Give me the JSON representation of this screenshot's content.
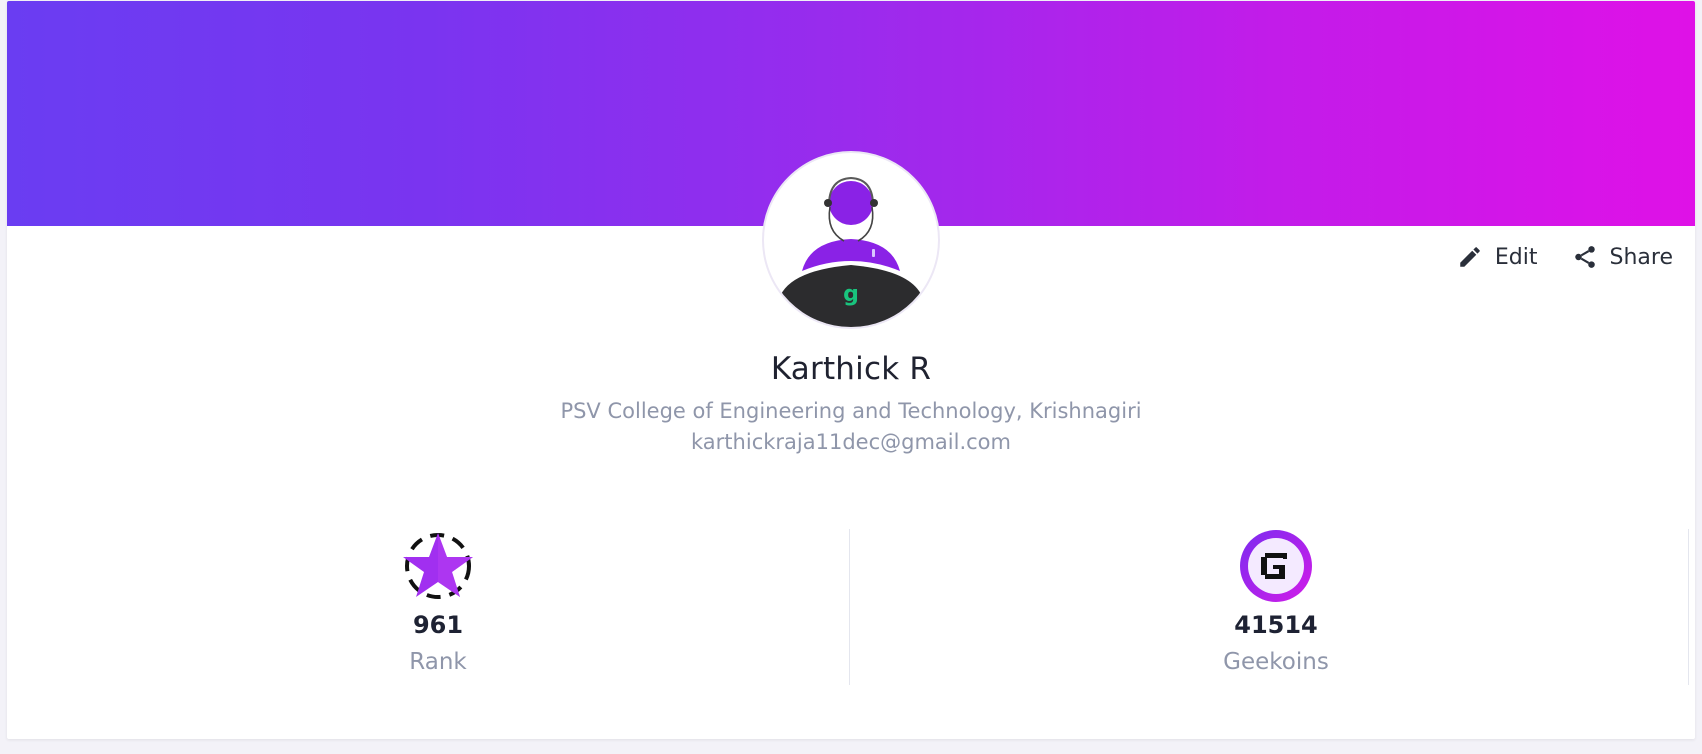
{
  "profile": {
    "name": "Karthick R",
    "college": "PSV College of Engineering and Technology, Krishnagiri",
    "email": "karthickraja11dec@gmail.com"
  },
  "actions": {
    "edit_label": "Edit",
    "share_label": "Share"
  },
  "stats": [
    {
      "value": "961",
      "label": "Rank",
      "icon": "star-badge-icon"
    },
    {
      "value": "41514",
      "label": "Geekoins",
      "icon": "geekoin-icon"
    }
  ],
  "colors": {
    "banner_start": "#6a3df2",
    "banner_end": "#df11e7",
    "accent_purple": "#8a22e6",
    "text_muted": "#8f96aa",
    "text_dark": "#1f2230"
  }
}
